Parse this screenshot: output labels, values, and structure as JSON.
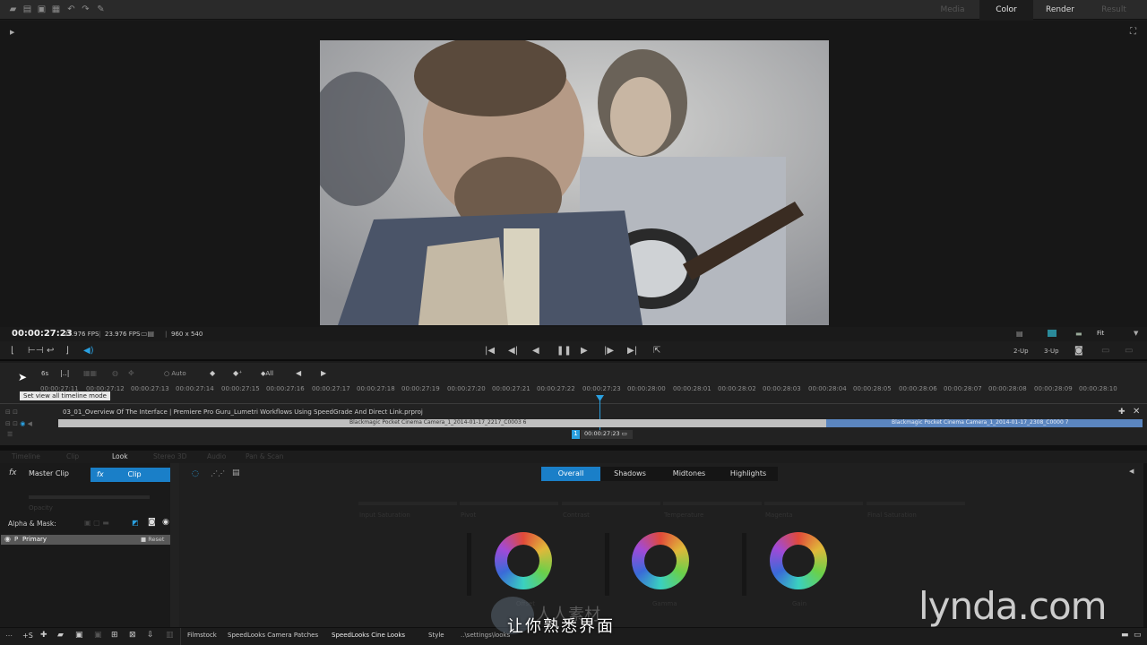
{
  "topbar": {
    "tabs": [
      "Media",
      "Color",
      "Render",
      "Result"
    ],
    "active_tab": "Color"
  },
  "viewer": {
    "timecode": "00:00:27:23",
    "fps_1": "23.976 FPS",
    "fps_2": "23.976 FPS",
    "resolution": "960 x 540",
    "view_modes": [
      "2-Up",
      "3-Up"
    ],
    "zoom": "Fit"
  },
  "timeline": {
    "tooltip": "Set view all timeline mode",
    "buttons": [
      "6s",
      "Auto",
      "All"
    ],
    "ruler": [
      "00:00:27:11",
      "00:00:27:12",
      "00:00:27:13",
      "00:00:27:14",
      "00:00:27:15",
      "00:00:27:16",
      "00:00:27:17",
      "00:00:27:18",
      "00:00:27:19",
      "00:00:27:20",
      "00:00:27:21",
      "00:00:27:22",
      "00:00:27:23",
      "00:00:28:00",
      "00:00:28:01",
      "00:00:28:02",
      "00:00:28:03",
      "00:00:28:04",
      "00:00:28:05",
      "00:00:28:06",
      "00:00:28:07",
      "00:00:28:08",
      "00:00:28:09",
      "00:00:28:10"
    ],
    "sequence_title": "03_01_Overview Of The Interface | Premiere Pro Guru_Lumetri Workflows Using SpeedGrade And Direct Link.prproj",
    "clip_1": "Blackmagic Pocket Cinema Camera_1_2014-01-17_2217_C0003 6",
    "clip_2": "Blackmagic Pocket Cinema Camera_1_2014-01-17_2308_C0000 7",
    "playhead_track": "1",
    "playhead_tc": "00:00:27:23"
  },
  "panel_tabs": [
    "Timeline",
    "Clip",
    "Look",
    "Stereo 3D",
    "Audio",
    "Pan & Scan"
  ],
  "left": {
    "master_clip": "Master Clip",
    "clip": "Clip",
    "opacity": "Opacity",
    "alpha_mask": "Alpha & Mask:",
    "layer": "Primary",
    "reset": "Reset"
  },
  "grading": {
    "tabs": [
      "Overall",
      "Shadows",
      "Midtones",
      "Highlights"
    ],
    "active": "Overall",
    "labels": [
      "Input Saturation",
      "Pivot",
      "Contrast",
      "Temperature",
      "Magenta",
      "Final Saturation"
    ],
    "wheel_labels": [
      "Offset",
      "Gamma",
      "Gain"
    ]
  },
  "bottom": {
    "plus_s": "+S",
    "looks_tabs": [
      "Filmstock",
      "SpeedLooks Camera Patches",
      "SpeedLooks Cine Looks",
      "Style"
    ],
    "path": "..\\settings\\looks"
  },
  "overlay": {
    "subtitle": "让你熟悉界面",
    "watermark": "lynda.com",
    "badge": "人人素材"
  },
  "colors": {
    "accent": "#2aa0e0",
    "active_tab": "#1a7fc8",
    "clip_selected": "#5b86c0"
  }
}
